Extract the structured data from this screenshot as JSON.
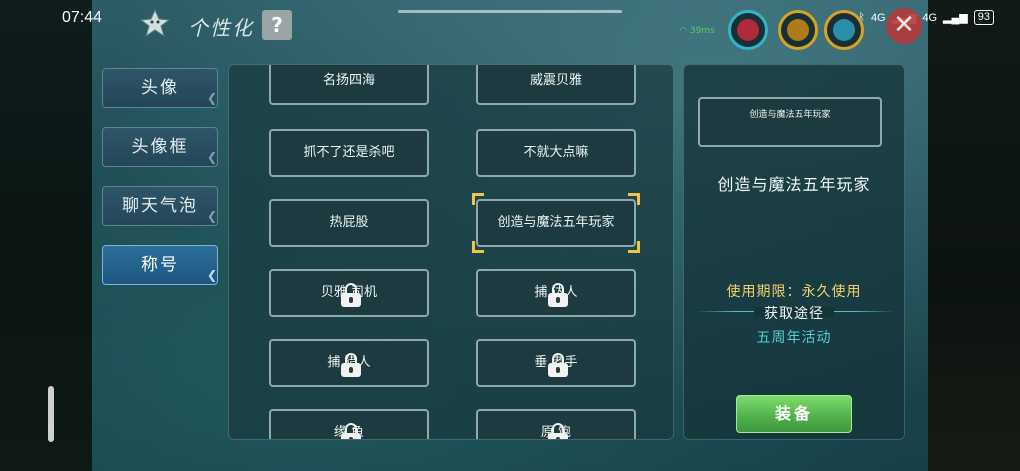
{
  "status_bar": {
    "time": "07:44",
    "network_1": "4G",
    "network_2": "4G",
    "battery": "93"
  },
  "header": {
    "title": "个性化",
    "help_label": "?"
  },
  "hud": {
    "signal_text": "39ms"
  },
  "categories": [
    {
      "label": "头像",
      "active": false
    },
    {
      "label": "头像框",
      "active": false
    },
    {
      "label": "聊天气泡",
      "active": false
    },
    {
      "label": "称号",
      "active": true
    }
  ],
  "titles": [
    {
      "label": "名扬四海",
      "locked": false
    },
    {
      "label": "威震贝雅",
      "locked": false
    },
    {
      "label": "抓不了还是杀吧",
      "locked": false
    },
    {
      "label": "不就大点嘛",
      "locked": false
    },
    {
      "label": "热屁股",
      "locked": false
    },
    {
      "label": "创造与魔法五年玩家",
      "locked": false,
      "selected": true
    },
    {
      "label": "贝雅 司机",
      "locked": true
    },
    {
      "label": "捕 达人",
      "locked": true
    },
    {
      "label": "捕 猎人",
      "locked": true
    },
    {
      "label": "垂 老手",
      "locked": true
    },
    {
      "label": "缘 鱼",
      "locked": true
    },
    {
      "label": "原 饱",
      "locked": true
    }
  ],
  "detail": {
    "preview_text": "创造与魔法五年玩家",
    "name": "创造与魔法五年玩家",
    "validity": "使用期限：永久使用",
    "obtain_label": "获取途径",
    "obtain_method": "五周年活动",
    "equip_label": "装备"
  },
  "colors": {
    "accent_gold": "#f0c34a",
    "equip_green": "#4fb04a",
    "obtain_teal": "#52d0d4"
  }
}
